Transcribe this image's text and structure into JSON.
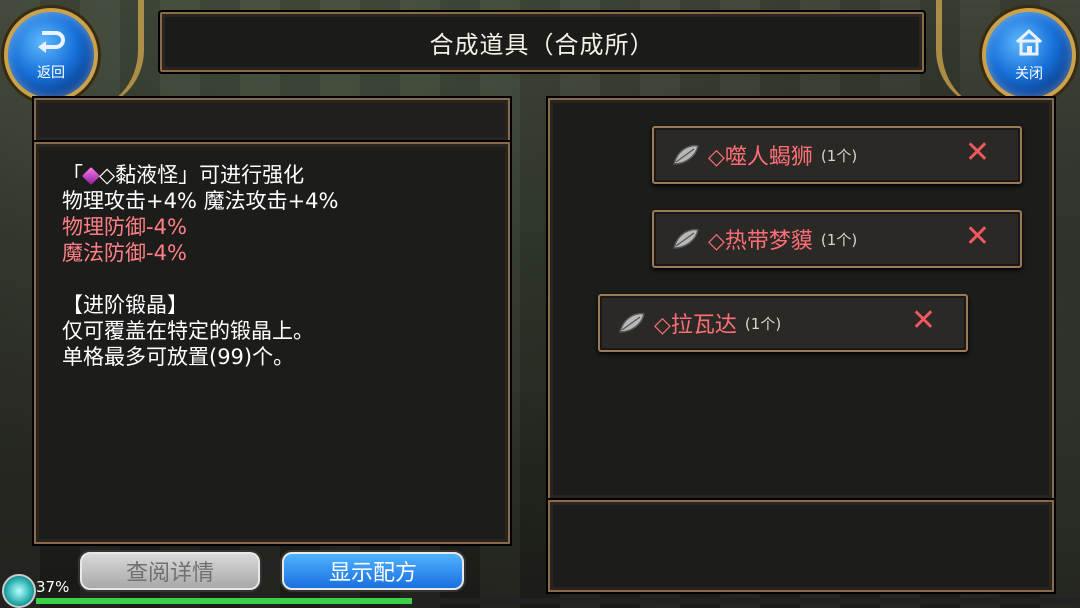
{
  "header": {
    "title": "合成道具（合成所）",
    "back_label": "返回",
    "close_label": "关闭"
  },
  "info": {
    "enhance_line_prefix": "「",
    "enhance_item": "◇黏液怪",
    "enhance_line_suffix": "」可进行强化",
    "stats_line": "物理攻击+4% 魔法攻击+4%",
    "phys_def": "物理防御-4%",
    "magic_def": "魔法防御-4%",
    "category": "【进阶锻晶】",
    "desc_1": "仅可覆盖在特定的锻晶上。",
    "desc_2": "单格最多可放置(99)个。"
  },
  "materials": [
    {
      "name": "◇噬人蝎狮",
      "count": "(1个)",
      "remove_icon": "✕"
    },
    {
      "name": "◇热带梦貘",
      "count": "(1个)",
      "remove_icon": "✕"
    },
    {
      "name": "◇拉瓦达",
      "count": "(1个)",
      "remove_icon": "✕"
    }
  ],
  "buttons": {
    "detail": "查阅详情",
    "show_recipe": "显示配方"
  },
  "status": {
    "battery": "37%",
    "progress": 0.36
  },
  "colors": {
    "accent_blue": "#1a6fe0",
    "penalty_red": "#ff7f86",
    "material_red": "#ff6e76",
    "frame_brown": "#8a6a4a"
  },
  "icons": {
    "back": "return-arrow-icon",
    "close": "home-icon",
    "leaf": "leaf-icon",
    "gem": "gem-icon",
    "remove": "close-icon"
  }
}
